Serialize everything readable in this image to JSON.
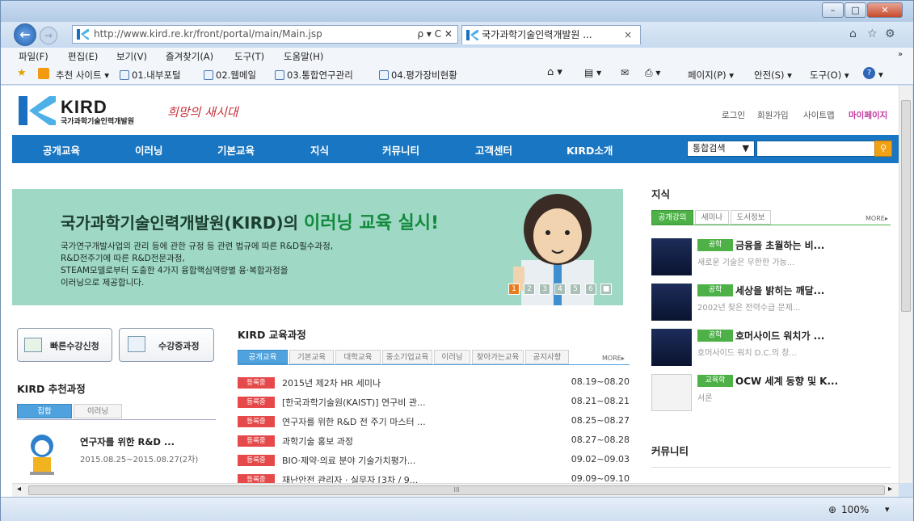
{
  "browser": {
    "url": "http://www.kird.re.kr/front/portal/main/Main.jsp",
    "tab_title": "국가과학기술인력개발원 ...",
    "tab_close": "×",
    "addr_controls": "ρ ▾ C ✕",
    "zoom": "100%",
    "hscroll_mark": "III"
  },
  "menu": [
    "파일(F)",
    "편집(E)",
    "보기(V)",
    "즐겨찾기(A)",
    "도구(T)",
    "도움말(H)"
  ],
  "favorites": [
    "추천 사이트 ▾",
    "01.내부포털",
    "02.웹메일",
    "03.통합연구관리",
    "04.평가장비현황"
  ],
  "cmdbar": [
    "페이지(P) ▾",
    "안전(S) ▾",
    "도구(O) ▾"
  ],
  "site": {
    "logo": "KIRD",
    "logo_sub": "국가과학기술인력개발원",
    "slogan": "희망의 새시대",
    "toplinks": [
      "로그인",
      "회원가입",
      "사이트맵",
      "마이페이지"
    ],
    "gnb": [
      "공개교육",
      "이러닝",
      "기본교육",
      "지식",
      "커뮤니티",
      "고객센터",
      "KIRD소개"
    ],
    "search_select": "통합검색"
  },
  "banner": {
    "title_pre": "국가과학기술인력개발원(KIRD)의 ",
    "title_hl": "이러닝 교육 실시!",
    "lines": [
      "국가연구개발사업의 관리 등에 관한 규정 등 관련 법규에 따른 R&D필수과정,",
      "R&D전주기에 따른 R&D전문과정,",
      "STEAM모델로부터 도출한 4가지 융합핵심역량별 융·복합과정을",
      "이러닝으로 제공합니다."
    ],
    "pages": [
      "1",
      "2",
      "3",
      "4",
      "5",
      "6",
      "■"
    ]
  },
  "quick": {
    "apply": "빠른수강신청",
    "ongoing": "수강중과정"
  },
  "recommend": {
    "title": "KIRD 추천과정",
    "tabs": [
      "집합",
      "이러닝"
    ],
    "item_title": "연구자를 위한 R&D ...",
    "item_date": "2015.08.25~2015.08.27(2차)"
  },
  "courses": {
    "title": "KIRD 교육과정",
    "tabs": [
      "공개교육",
      "기본교육",
      "대학교육",
      "중소기업교육",
      "이러닝",
      "찾아가는교육",
      "공지사항"
    ],
    "more": "MORE▸",
    "badge": "등록중",
    "rows": [
      {
        "title": "2015년 제2차 HR 세미나",
        "date": "08.19~08.20"
      },
      {
        "title": "[한국과학기술원(KAIST)] 연구비 관...",
        "date": "08.21~08.21"
      },
      {
        "title": "연구자를 위한 R&D 전 주기 마스터 ...",
        "date": "08.25~08.27"
      },
      {
        "title": "과학기술 홍보 과정",
        "date": "08.27~08.28"
      },
      {
        "title": "BIO·제약·의료 분야 기술가치평가...",
        "date": "09.02~09.03"
      },
      {
        "title": "재난안전 관리자 · 실무자 [3차 / 9...",
        "date": "09.09~09.10"
      }
    ]
  },
  "knowledge": {
    "title": "지식",
    "tabs": [
      "공개강의",
      "세미나",
      "도서정보"
    ],
    "more": "MORE▸",
    "items": [
      {
        "badge": "공학",
        "title": "금융을 초월하는 비...",
        "desc": "새로운 기술은 무한한 가능..."
      },
      {
        "badge": "공학",
        "title": "세상을 밝히는 깨달...",
        "desc": "2002년 찾은 전력수급 문제..."
      },
      {
        "badge": "공학",
        "title": "호머사이드 워치가 ...",
        "desc": "호머사이드 워치 D.C.의 창..."
      },
      {
        "badge": "교육학",
        "title": "OCW 세계 동향 및 K...",
        "desc": "서론"
      }
    ]
  },
  "community": {
    "title": "커뮤니티"
  }
}
